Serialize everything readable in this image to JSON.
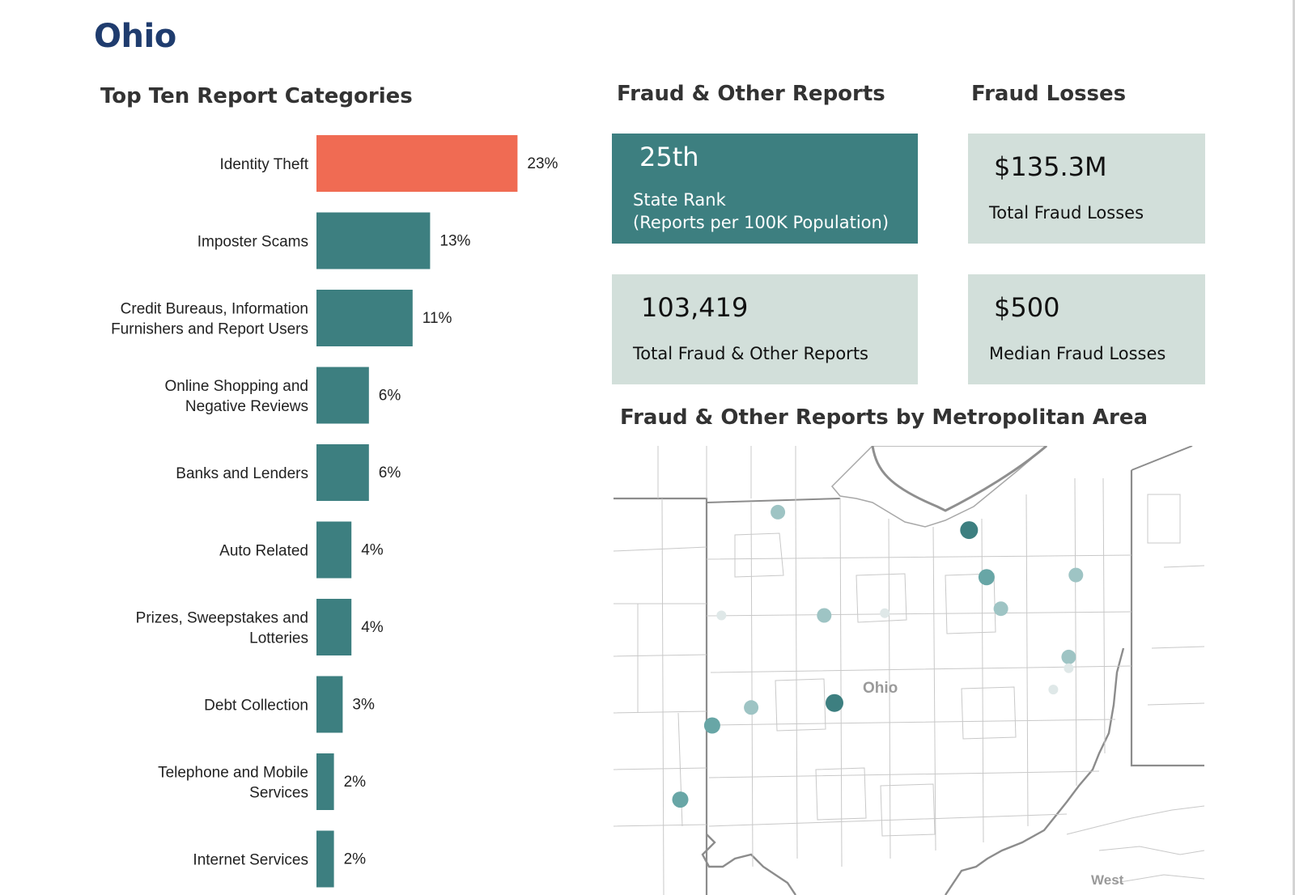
{
  "page": {
    "state": "Ohio"
  },
  "sections": {
    "top_ten_title": "Top Ten Report Categories",
    "fraud_reports_title": "Fraud & Other Reports",
    "fraud_losses_title": "Fraud Losses",
    "metro_title": "Fraud & Other Reports by Metropolitan Area"
  },
  "cards": {
    "state_rank": {
      "value": "25th",
      "label": "State Rank\n(Reports per 100K Population)"
    },
    "total_reports": {
      "value": "103,419",
      "label": "Total Fraud & Other Reports"
    },
    "total_losses": {
      "value": "$135.3M",
      "label": "Total Fraud Losses"
    },
    "median_losses": {
      "value": "$500",
      "label": "Median Fraud Losses"
    }
  },
  "colors": {
    "highlight_bar": "#f06b53",
    "bar": "#3d7f80",
    "card_dark": "#3d7f80",
    "card_light": "#d2dfda",
    "title_blue": "#1f3c6e"
  },
  "chart_data": {
    "type": "bar",
    "orientation": "horizontal",
    "title": "Top Ten Report Categories",
    "categories": [
      "Identity Theft",
      "Imposter Scams",
      "Credit Bureaus, Information Furnishers and Report Users",
      "Online Shopping and Negative Reviews",
      "Banks and Lenders",
      "Auto Related",
      "Prizes, Sweepstakes and Lotteries",
      "Debt Collection",
      "Telephone and Mobile Services",
      "Internet Services"
    ],
    "values": [
      23,
      13,
      11,
      6,
      6,
      4,
      4,
      3,
      2,
      2
    ],
    "data_labels": [
      "23%",
      "13%",
      "11%",
      "6%",
      "6%",
      "4%",
      "4%",
      "3%",
      "2%",
      "2%"
    ],
    "highlight_index": 0,
    "unit": "%"
  },
  "map": {
    "state_label": "Ohio",
    "neighbor_label": "West",
    "metro_points": [
      {
        "lon": -84.5,
        "lat": 39.1,
        "level": "medium"
      },
      {
        "lon": -84.19,
        "lat": 39.76,
        "level": "medium"
      },
      {
        "lon": -83.81,
        "lat": 39.92,
        "level": "light"
      },
      {
        "lon": -83.0,
        "lat": 39.96,
        "level": "high"
      },
      {
        "lon": -83.55,
        "lat": 41.66,
        "level": "light"
      },
      {
        "lon": -83.1,
        "lat": 40.74,
        "level": "light"
      },
      {
        "lon": -84.1,
        "lat": 40.74,
        "level": "faint"
      },
      {
        "lon": -82.51,
        "lat": 40.76,
        "level": "faint"
      },
      {
        "lon": -81.69,
        "lat": 41.5,
        "level": "high"
      },
      {
        "lon": -81.52,
        "lat": 41.08,
        "level": "medium"
      },
      {
        "lon": -81.38,
        "lat": 40.8,
        "level": "light"
      },
      {
        "lon": -80.65,
        "lat": 41.1,
        "level": "light"
      },
      {
        "lon": -80.72,
        "lat": 40.37,
        "level": "light"
      },
      {
        "lon": -80.87,
        "lat": 40.08,
        "level": "faint"
      },
      {
        "lon": -80.72,
        "lat": 40.27,
        "level": "faint"
      }
    ],
    "level_colors": {
      "high": "#3d7f80",
      "medium": "#68a6a6",
      "light": "#9ec4c4",
      "faint": "#dfe8e8"
    }
  }
}
